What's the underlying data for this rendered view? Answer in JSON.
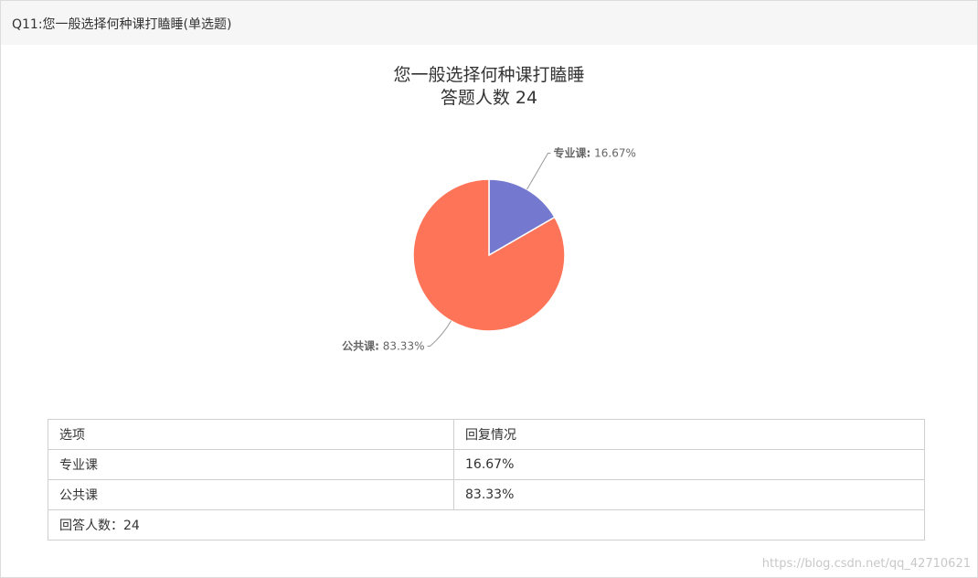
{
  "question": {
    "title": "Q11:您一般选择何种课打瞌睡(单选题)"
  },
  "chart_data": {
    "type": "pie",
    "title": "您一般选择何种课打瞌睡",
    "subtitle": "答题人数 24",
    "slices": [
      {
        "name": "专业课",
        "value": 16.67,
        "label": "16.67%",
        "color": "#7479cf"
      },
      {
        "name": "公共课",
        "value": 83.33,
        "label": "83.33%",
        "color": "#fe7458"
      }
    ]
  },
  "table": {
    "header": {
      "option": "选项",
      "result": "回复情况"
    },
    "rows": [
      {
        "option": "专业课",
        "result": "16.67%"
      },
      {
        "option": "公共课",
        "result": "83.33%"
      }
    ],
    "footer": "回答人数：24"
  },
  "watermark": "https://blog.csdn.net/qq_42710621"
}
